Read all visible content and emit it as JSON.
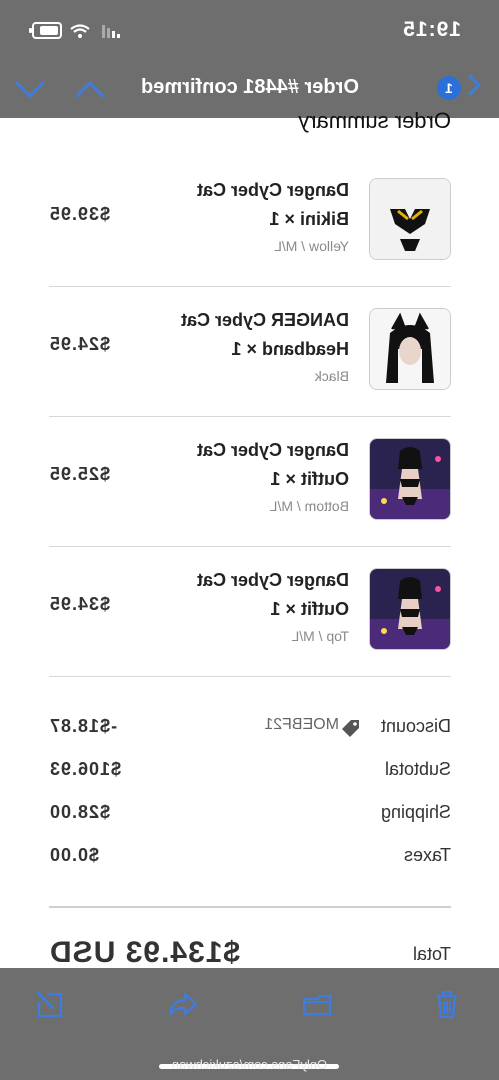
{
  "status_bar": {
    "time": "19:15"
  },
  "nav": {
    "title": "Order #4481 confirmed",
    "badge_count": "1"
  },
  "summary": {
    "title": "Order summary"
  },
  "items": [
    {
      "name": "Danger Cyber Cat Bikini × 1",
      "variant": "Yellow / M/L",
      "price": "$39.95"
    },
    {
      "name": "DANGER Cyber Cat Headband × 1",
      "variant": "Black",
      "price": "$24.95"
    },
    {
      "name": "Danger Cyber Cat Outfit × 1",
      "variant": "Bottom / M/L",
      "price": "$25.95"
    },
    {
      "name": "Danger Cyber Cat Outfit × 1",
      "variant": "Top / M/L",
      "price": "$34.95"
    }
  ],
  "totals": {
    "discount_label": "Discount",
    "discount_code": "MOEBF21",
    "discount_value": "-$18.87",
    "subtotal_label": "Subtotal",
    "subtotal_value": "$106.93",
    "shipping_label": "Shipping",
    "shipping_value": "$28.00",
    "taxes_label": "Taxes",
    "taxes_value": "$0.00",
    "total_label": "Total",
    "total_value": "$134.93 USD"
  },
  "watermark": "OnlyFans.com/azukichwan",
  "colors": {
    "bar": "#6e6e6e",
    "accent": "#2b6fd8"
  },
  "icons": [
    "back-chevron-icon",
    "down-chevron-icon",
    "up-chevron-icon",
    "tag-icon",
    "trash-icon",
    "folder-icon",
    "reply-icon",
    "compose-icon",
    "battery-icon",
    "wifi-icon",
    "signal-icon"
  ]
}
